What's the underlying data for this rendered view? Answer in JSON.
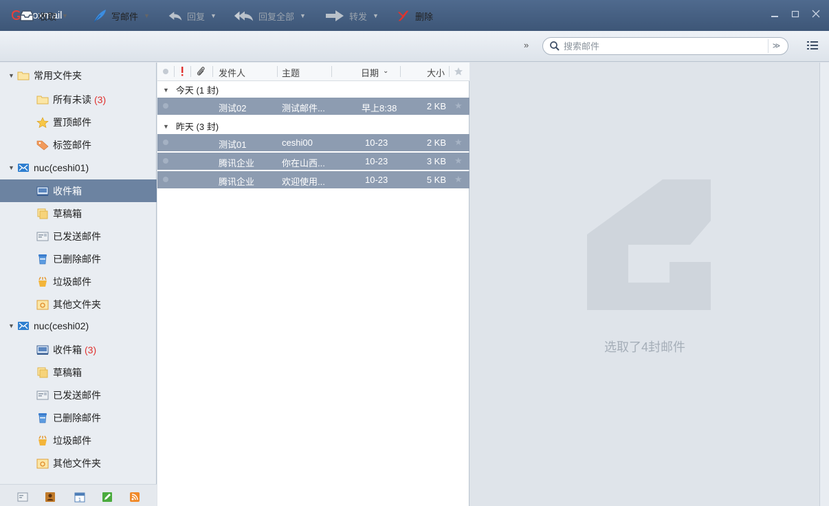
{
  "window": {
    "title": "Foxmail",
    "controls": [
      "minimize",
      "maximize",
      "close"
    ]
  },
  "toolbar": {
    "receive": "收取",
    "compose": "写邮件",
    "reply": "回复",
    "reply_all": "回复全部",
    "forward": "转发",
    "delete": "删除",
    "more": "»",
    "search_placeholder": "搜索邮件",
    "search_option": "≫"
  },
  "sidebar": {
    "favorites": {
      "label": "常用文件夹",
      "items": [
        {
          "label": "所有未读",
          "count": "(3)"
        },
        {
          "label": "置顶邮件"
        },
        {
          "label": "标签邮件"
        }
      ]
    },
    "accounts": [
      {
        "label": "nuc(ceshi01)",
        "items": [
          {
            "label": "收件箱",
            "selected": true
          },
          {
            "label": "草稿箱"
          },
          {
            "label": "已发送邮件"
          },
          {
            "label": "已删除邮件"
          },
          {
            "label": "垃圾邮件"
          },
          {
            "label": "其他文件夹"
          }
        ]
      },
      {
        "label": "nuc(ceshi02)",
        "items": [
          {
            "label": "收件箱",
            "count": "(3)"
          },
          {
            "label": "草稿箱"
          },
          {
            "label": "已发送邮件"
          },
          {
            "label": "已删除邮件"
          },
          {
            "label": "垃圾邮件"
          },
          {
            "label": "其他文件夹"
          }
        ]
      }
    ]
  },
  "list": {
    "columns": {
      "sender": "发件人",
      "subject": "主题",
      "date": "日期",
      "size": "大小"
    },
    "groups": [
      {
        "label": "今天 (1 封)",
        "rows": [
          {
            "sender": "测试02",
            "subject": "测试邮件...",
            "date": "早上8:38",
            "size": "2 KB"
          }
        ]
      },
      {
        "label": "昨天 (3 封)",
        "rows": [
          {
            "sender": "测试01",
            "subject": "ceshi00",
            "date": "10-23",
            "size": "2 KB"
          },
          {
            "sender": "腾讯企业",
            "subject": "你在山西...",
            "date": "10-23",
            "size": "3 KB"
          },
          {
            "sender": "腾讯企业",
            "subject": "欢迎使用...",
            "date": "10-23",
            "size": "5 KB"
          }
        ]
      }
    ]
  },
  "preview": {
    "message": "选取了4封邮件"
  },
  "colors": {
    "titlebar": "#43597a",
    "selected": "#6c83a1",
    "selected_rows": "#8d9cb1",
    "unread_count": "#e0312e"
  }
}
